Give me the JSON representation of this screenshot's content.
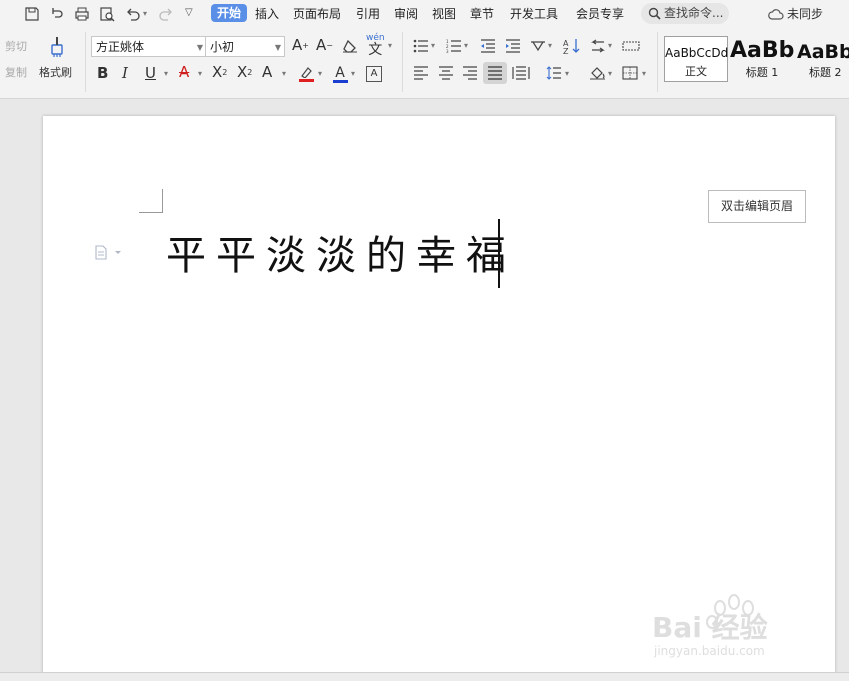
{
  "menu": {
    "tabs": [
      "开始",
      "插入",
      "页面布局",
      "引用",
      "审阅",
      "视图",
      "章节",
      "开发工具",
      "会员专享"
    ],
    "active_tab": "开始",
    "search_label": "查找命令...",
    "sync_label": "未同步"
  },
  "clipboard": {
    "cut_label": "剪切",
    "copy_label": "复制",
    "format_painter_label": "格式刷"
  },
  "font": {
    "family": "方正姚体",
    "size": "小初",
    "phonetic_glyph": "wén"
  },
  "styles": [
    {
      "preview": "AaBbCcDd",
      "name": "正文"
    },
    {
      "preview": "AaBb",
      "name": "标题 1"
    },
    {
      "preview": "AaBb",
      "name": "标题 2"
    }
  ],
  "document": {
    "header_hint": "双击编辑页眉",
    "body_text": "平平淡淡的幸福"
  },
  "watermark": {
    "brand": "Bai 经验",
    "url": "jingyan.baidu.com"
  },
  "colors": {
    "accent": "#5a8fe8",
    "font_color_bar": "#e02020",
    "highlight_bar": "#e02020",
    "font_color2_bar": "#1a3fd0"
  }
}
